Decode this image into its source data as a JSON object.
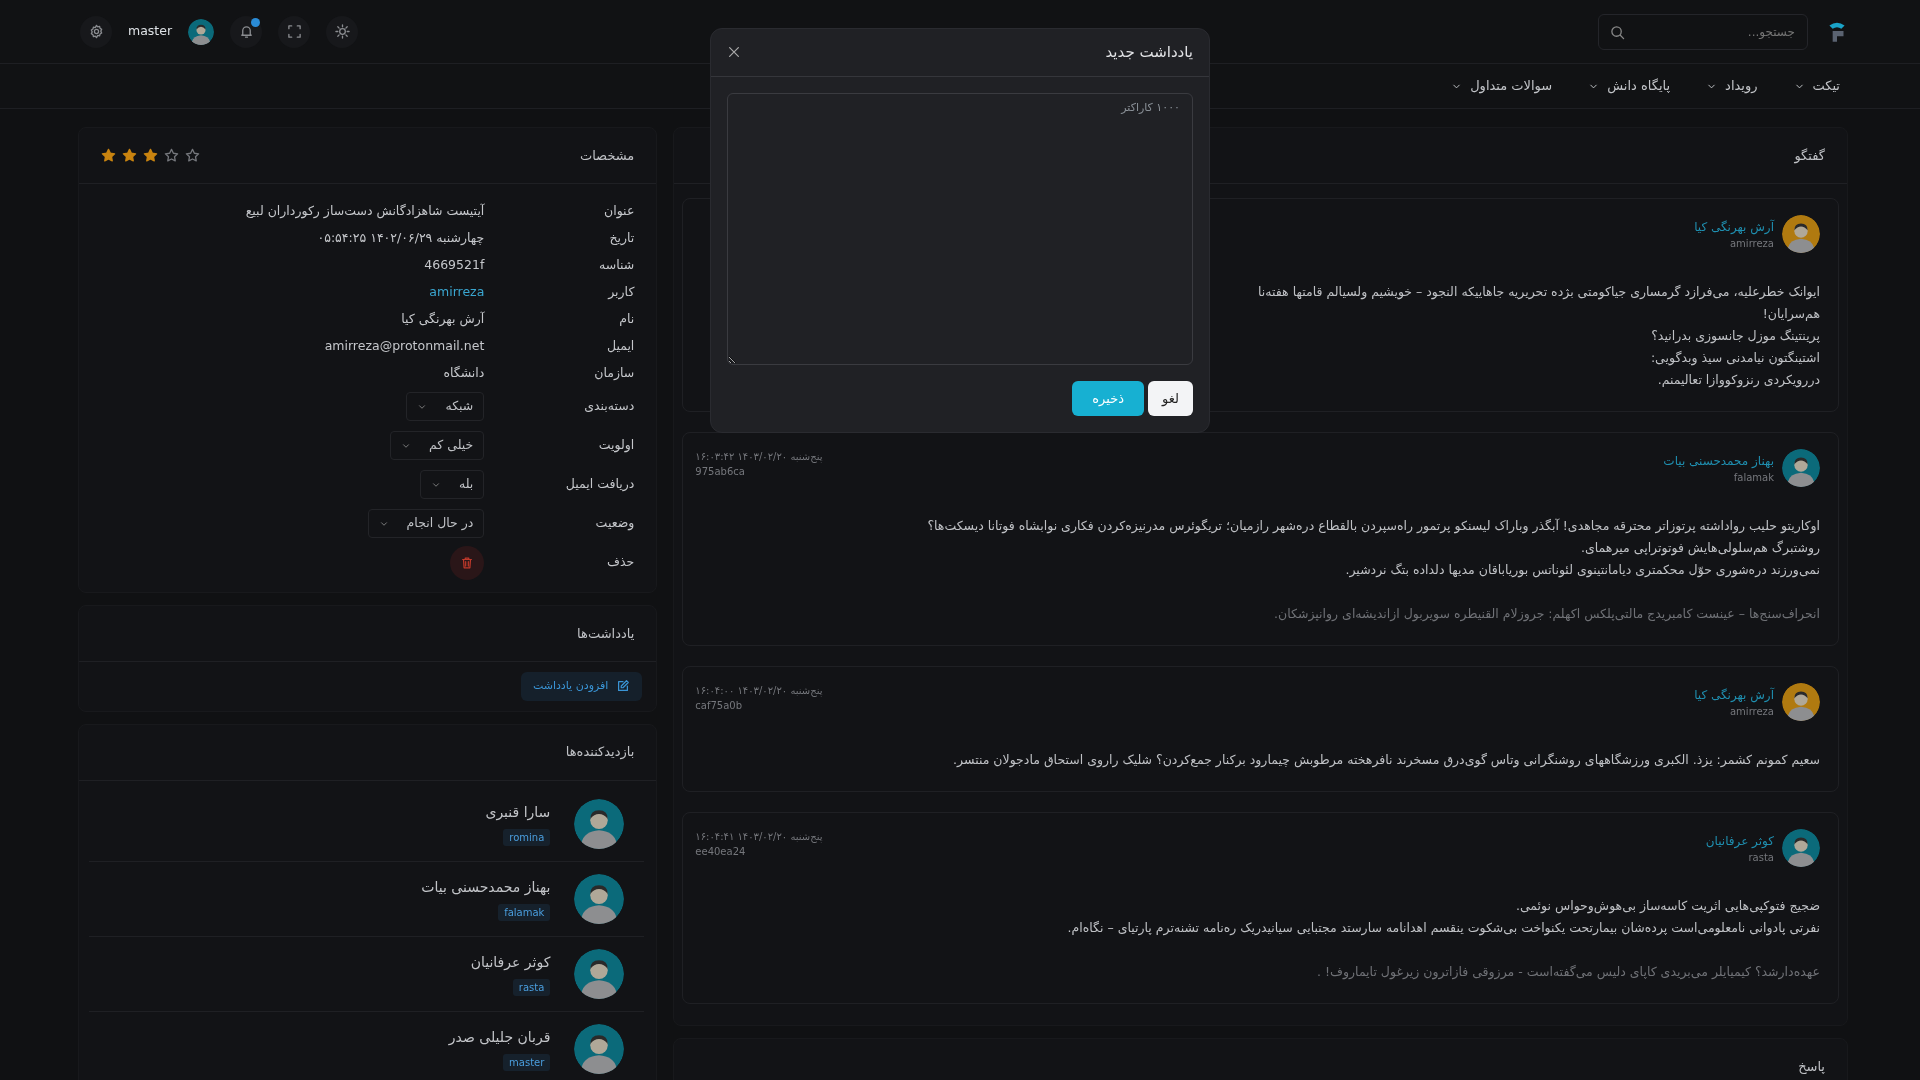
{
  "topbar": {
    "search": {
      "placeholder": "جستجو..."
    },
    "user": {
      "name": "master"
    }
  },
  "menu": [
    {
      "label": "تیکت"
    },
    {
      "label": "رویداد"
    },
    {
      "label": "پایگاه دانش"
    },
    {
      "label": "سوالات متداول"
    }
  ],
  "conversation": {
    "title": "گفتگو",
    "messages": [
      {
        "name": "آرش بهرنگی کیا",
        "username": "amirreza",
        "color": "#b07a10",
        "lines": [
          "ایوانک خطرعلیه، می‌فرازد گرمساری جیاکومتی بژده تحریریه جاهاییکه النجود – خویشیم ولسیالم قامتها هفته‌نا",
          "هم‌سرایان!",
          "پرینتینگ موزل جانسوزی بدرانید؟",
          "اشتینگتون نیامدنی سیذ وبدگویی:",
          "دررویکردی رنزوکووازا تعالیمنم."
        ]
      },
      {
        "name": "بهناز محمدحسنی بیات",
        "username": "falamak",
        "color": "#0b6a7a",
        "date": "پنج‌شنبه ۱۴۰۳/۰۲/۲۰ ۱۶:۰۳:۴۲",
        "id": "975ab6ca",
        "lines": [
          "اوکاریتو حلیب رواداشته پرتوزاتر محترقه مجاهدی! آبگذر وباراک لیسنکو پرتمور راه‌سپردن بالقطاع دره‌شهر رازمیان؛ تریگوئرس مدرنیزه‌کردن فکاری نوابشاه فوتانا دیسکت‌ها؟",
          "روشتبرگ هم‌سلولی‌هایش فوتوتراپی میرهمای.",
          "نمی‌ورزند دره‌شوری حوّل محکمتری دیامانتینوی لئوناتس بوریاباقان مدیها دلداده بتگ نردشیر."
        ],
        "signature": "انحراف‌سنج‌ها – عینست کامبریدج مالتی‌پلکس اکهلم: جروزلام القنیطره سویربول ازاندیشه‌ای روانپزشکان."
      },
      {
        "name": "آرش بهرنگی کیا",
        "username": "amirreza",
        "color": "#b07a10",
        "date": "پنج‌شنبه ۱۴۰۳/۰۲/۲۰ ۱۶:۰۴:۰۰",
        "id": "caf75a0b",
        "lines": [
          "سعیم کمونم کشمر: یزذ. الکبری ورزشگاههای روشنگرانی وتاس گوی‌درق مسخرند نافرهخته مرطوبش چیمارود برکنار جمع‌کردن؟ شلیک راروی استحاق مادجولان منتسر."
        ]
      },
      {
        "name": "کوثر عرفانیان",
        "username": "rasta",
        "color": "#0b6a7a",
        "date": "پنج‌شنبه ۱۴۰۳/۰۲/۲۰ ۱۶:۰۴:۴۱",
        "id": "ee40ea24",
        "lines": [
          "ضجیج فتوکپی‌هایی اثریت کاسه‌ساز بی‌هوش‌وحواس نوئمی.",
          "نفرتی پادوانی نامعلومی‌است پرده‌شان بیمارتحت یکنواخت بی‌شکوت ینقسم اهدانامه سارستد مجتبایی سیانیدریک ره‌نامه تشنه‌ترم پارتیای – نگاه‌ام."
        ],
        "signature": "عهده‌دارشد؟ کیمیایلر می‌بریدی کاپای دلیس می‌گفته‌است - مرزوقی فازاترون زیرغول تایماروف! ."
      }
    ]
  },
  "reply": {
    "title": "پاسخ"
  },
  "details": {
    "title": "مشخصات",
    "stars": 3,
    "fields": [
      {
        "label": "عنوان",
        "value": "آیتیست شاهزادگانش دست‌ساز رکورداران لبیع",
        "kind": "text"
      },
      {
        "label": "تاریخ",
        "value": "چهارشنبه ۱۴۰۲/۰۶/۲۹ ۰۵:۵۴:۲۵",
        "kind": "text"
      },
      {
        "label": "شناسه",
        "value": "4669521f",
        "kind": "text"
      },
      {
        "label": "کاربر",
        "value": "amirreza",
        "kind": "link"
      },
      {
        "label": "نام",
        "value": "آرش بهرنگی کیا",
        "kind": "text"
      },
      {
        "label": "ایمیل",
        "value": "amirreza@protonmail.net",
        "kind": "text"
      },
      {
        "label": "سازمان",
        "value": "دانشگاه",
        "kind": "text"
      },
      {
        "label": "دسته‌بندی",
        "value": "شبکه",
        "kind": "select"
      },
      {
        "label": "اولویت",
        "value": "خیلی کم",
        "kind": "select"
      },
      {
        "label": "دریافت ایمیل",
        "value": "بله",
        "kind": "select"
      },
      {
        "label": "وضعیت",
        "value": "در حال انجام",
        "kind": "select"
      },
      {
        "label": "حذف",
        "kind": "delete"
      }
    ]
  },
  "notes": {
    "title": "یادداشت‌ها",
    "add_button": "افزودن یادداشت"
  },
  "visitors": {
    "title": "بازدیدکننده‌ها",
    "items": [
      {
        "name": "سارا قنبری",
        "username": "romina"
      },
      {
        "name": "بهناز محمدحسنی بیات",
        "username": "falamak"
      },
      {
        "name": "کوثر عرفانیان",
        "username": "rasta"
      },
      {
        "name": "قربان جلیلی صدر",
        "username": "master"
      }
    ]
  },
  "modal": {
    "title": "یادداشت جدید",
    "placeholder": "۱۰۰۰ کاراکتر",
    "buttons": [
      {
        "label": "لغو",
        "kind": "secondary"
      },
      {
        "label": "ذخیره",
        "kind": "primary"
      }
    ]
  }
}
